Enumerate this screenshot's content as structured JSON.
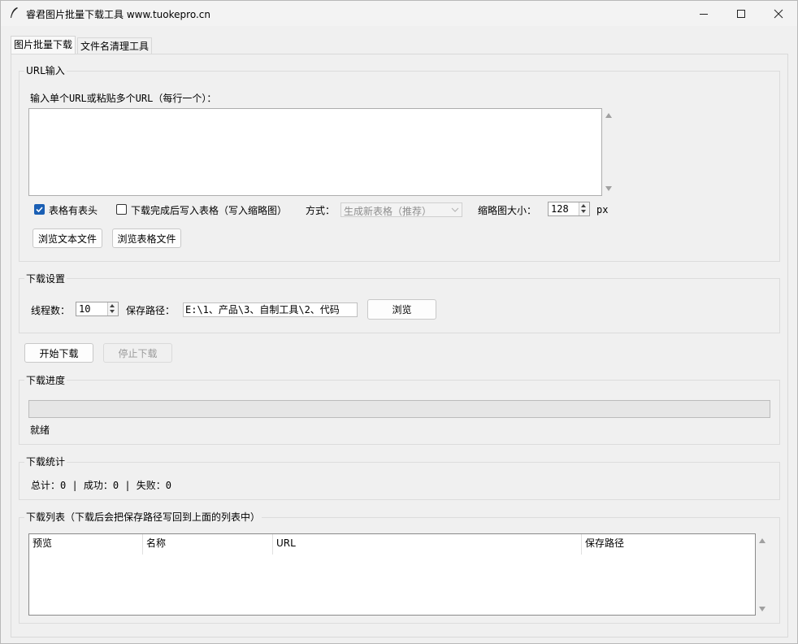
{
  "window": {
    "title": "睿君图片批量下载工具  www.tuokepro.cn"
  },
  "tabs": [
    {
      "label": "图片批量下载"
    },
    {
      "label": "文件名清理工具"
    }
  ],
  "url_group": {
    "legend": "URL输入",
    "prompt": "输入单个URL或粘贴多个URL（每行一个）：",
    "text": "",
    "header_checkbox_label": "表格有表头",
    "header_checked": true,
    "write_back_checkbox_label": "下载完成后写入表格（写入缩略图）",
    "write_back_checked": false,
    "mode_label": "方式：",
    "mode_value": "生成新表格（推荐）",
    "thumb_label": "缩略图大小：",
    "thumb_value": "128",
    "thumb_unit": "px",
    "browse_text_button": "浏览文本文件",
    "browse_table_button": "浏览表格文件"
  },
  "settings_group": {
    "legend": "下载设置",
    "threads_label": "线程数：",
    "threads_value": "10",
    "save_path_label": "保存路径：",
    "save_path_value": "E:\\1、产品\\3、自制工具\\2、代码",
    "browse_button": "浏览"
  },
  "actions": {
    "start_button": "开始下载",
    "stop_button": "停止下载"
  },
  "progress_group": {
    "legend": "下载进度",
    "progress_fraction": 0,
    "status": "就绪"
  },
  "stats_group": {
    "legend": "下载统计",
    "summary": "总计：0 | 成功：0 | 失败：0"
  },
  "list_group": {
    "legend": "下载列表（下载后会把保存路径写回到上面的列表中）",
    "columns": [
      "预览",
      "名称",
      "URL",
      "保存路径"
    ],
    "rows": []
  }
}
